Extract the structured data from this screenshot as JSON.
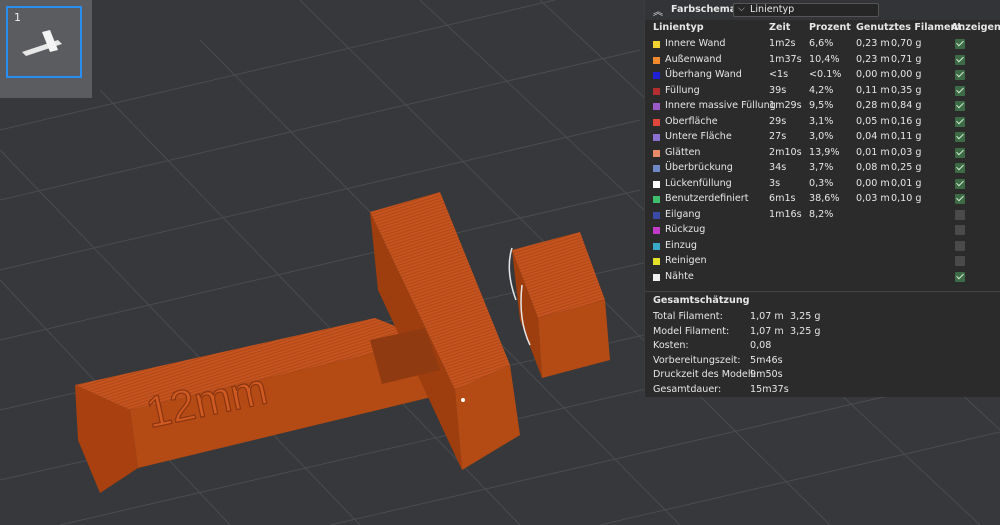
{
  "thumbnail": {
    "number": "1"
  },
  "model": {
    "label": "12mm",
    "color": "#c8551d"
  },
  "legend": {
    "title": "Farbschema",
    "dropdown_value": "Linientyp",
    "columns": [
      "Linientyp",
      "Zeit",
      "Prozent",
      "Genutztes Filament",
      "Anzeigen"
    ],
    "rows": [
      {
        "color": "#f2d233",
        "name": "Innere Wand",
        "time": "1m2s",
        "pct": "6,6%",
        "m": "0,23 m",
        "g": "0,70 g",
        "shown": true
      },
      {
        "color": "#f28a2e",
        "name": "Außenwand",
        "time": "1m37s",
        "pct": "10,4%",
        "m": "0,23 m",
        "g": "0,71 g",
        "shown": true
      },
      {
        "color": "#1f1fd6",
        "name": "Überhang Wand",
        "time": "<1s",
        "pct": "<0.1%",
        "m": "0,00 m",
        "g": "0,00 g",
        "shown": true
      },
      {
        "color": "#b32e2e",
        "name": "Füllung",
        "time": "39s",
        "pct": "4,2%",
        "m": "0,11 m",
        "g": "0,35 g",
        "shown": true
      },
      {
        "color": "#9b59c9",
        "name": "Innere massive Füllung",
        "time": "1m29s",
        "pct": "9,5%",
        "m": "0,28 m",
        "g": "0,84 g",
        "shown": true
      },
      {
        "color": "#e0463a",
        "name": "Oberfläche",
        "time": "29s",
        "pct": "3,1%",
        "m": "0,05 m",
        "g": "0,16 g",
        "shown": true
      },
      {
        "color": "#8b6fd1",
        "name": "Untere Fläche",
        "time": "27s",
        "pct": "3,0%",
        "m": "0,04 m",
        "g": "0,11 g",
        "shown": true
      },
      {
        "color": "#e88a6a",
        "name": "Glätten",
        "time": "2m10s",
        "pct": "13,9%",
        "m": "0,01 m",
        "g": "0,03 g",
        "shown": true
      },
      {
        "color": "#6f88c6",
        "name": "Überbrückung",
        "time": "34s",
        "pct": "3,7%",
        "m": "0,08 m",
        "g": "0,25 g",
        "shown": true
      },
      {
        "color": "#ffffff",
        "name": "Lückenfüllung",
        "time": "3s",
        "pct": "0,3%",
        "m": "0,00 m",
        "g": "0,01 g",
        "shown": true
      },
      {
        "color": "#3fbf6e",
        "name": "Benutzerdefiniert",
        "time": "6m1s",
        "pct": "38,6%",
        "m": "0,03 m",
        "g": "0,10 g",
        "shown": true
      },
      {
        "color": "#3a4aa8",
        "name": "Eilgang",
        "time": "1m16s",
        "pct": "8,2%",
        "m": "",
        "g": "",
        "shown": false
      },
      {
        "color": "#c23ac8",
        "name": "Rückzug",
        "time": "",
        "pct": "",
        "m": "",
        "g": "",
        "shown": false
      },
      {
        "color": "#3aa8c8",
        "name": "Einzug",
        "time": "",
        "pct": "",
        "m": "",
        "g": "",
        "shown": false
      },
      {
        "color": "#e6e22a",
        "name": "Reinigen",
        "time": "",
        "pct": "",
        "m": "",
        "g": "",
        "shown": false
      },
      {
        "color": "#f0f0f0",
        "name": "Nähte",
        "time": "",
        "pct": "",
        "m": "",
        "g": "",
        "shown": true
      }
    ]
  },
  "summary": {
    "title": "Gesamtschätzung",
    "rows": [
      {
        "label": "Total Filament:",
        "v1": "1,07 m",
        "v2": "3,25 g"
      },
      {
        "label": "Model Filament:",
        "v1": "1,07 m",
        "v2": "3,25 g"
      },
      {
        "label": "Kosten:",
        "v1": "0,08",
        "v2": ""
      },
      {
        "label": "Vorbereitungszeit:",
        "v1": "5m46s",
        "v2": ""
      },
      {
        "label": "Druckzeit des Modell:",
        "v1": "9m50s",
        "v2": ""
      },
      {
        "label": "Gesamtdauer:",
        "v1": "15m37s",
        "v2": ""
      }
    ]
  }
}
